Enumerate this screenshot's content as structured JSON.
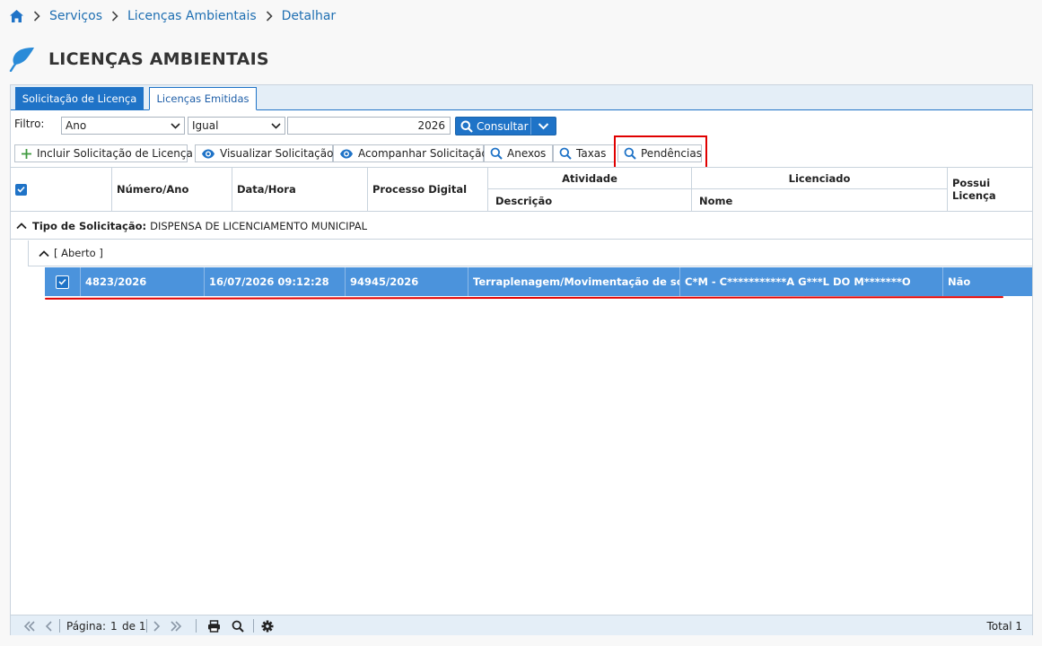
{
  "breadcrumb": {
    "items": [
      "Serviços",
      "Licenças Ambientais",
      "Detalhar"
    ]
  },
  "page": {
    "title": "LICENÇAS AMBIENTAIS"
  },
  "tabs": {
    "solicitacao": "Solicitação de Licença",
    "emitidas": "Licenças Emitidas"
  },
  "filter": {
    "label": "Filtro:",
    "field": "Ano",
    "operator": "Igual",
    "value": "2026",
    "consultar": "Consultar"
  },
  "toolbar": {
    "incluir": "Incluir Solicitação de Licença",
    "visualizar": "Visualizar Solicitação",
    "acompanhar": "Acompanhar Solicitação",
    "anexos": "Anexos",
    "taxas": "Taxas",
    "pendencias": "Pendências"
  },
  "grid": {
    "headers": {
      "numero": "Número/Ano",
      "data": "Data/Hora",
      "processo": "Processo Digital",
      "atividade": "Atividade",
      "descricao": "Descrição",
      "licenciado": "Licenciado",
      "nome": "Nome",
      "possui": "Possui Licença"
    },
    "group1": {
      "label": "Tipo de Solicitação:",
      "value": "DISPENSA DE LICENCIAMENTO MUNICIPAL"
    },
    "group2": {
      "label": "[ Aberto ]"
    },
    "rows": [
      {
        "numero": "4823/2026",
        "data": "16/07/2026 09:12:28",
        "processo": "94945/2026",
        "descricao": "Terraplenagem/Movimentação de solo (s...",
        "nome": "C*M - C***********A G***L DO M*******O",
        "possui": "Não"
      }
    ]
  },
  "footer": {
    "pagina_label": "Página:",
    "pagina": "1",
    "de_label": "de 1",
    "total": "Total 1"
  },
  "colors": {
    "accent": "#1f73c7",
    "selected_row": "#4b93dc",
    "highlight": "#e00000",
    "link": "#1f6fb2"
  }
}
